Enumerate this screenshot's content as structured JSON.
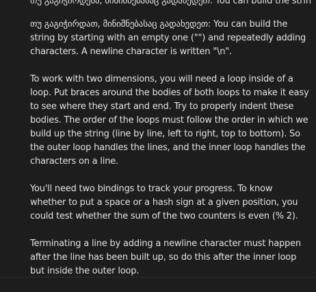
{
  "hints": {
    "top_partial_line": "თუ გაგიჭირდება, მინიშნებასაც გადახედეთ: You can build the string by starting with an empty one",
    "paragraphs": [
      "თუ გაგიჭირდათ, მინიშნებასაც გადახედეთ: You can build the string by starting with an empty one (\"\") and repeatedly adding characters. A newline character is written \"\\n\".",
      "To work with two dimensions, you will need a loop inside of a loop. Put braces around the bodies of both loops to make it easy to see where they start and end. Try to properly indent these bodies. The order of the loops must follow the order in which we build up the string (line by line, left to right, top to bottom). So the outer loop handles the lines, and the inner loop handles the characters on a line.",
      "You'll need two bindings to track your progress. To know whether to put a space or a hash sign at a given position, you could test whether the sum of the two counters is even (% 2).",
      "Terminating a line by adding a newline character must happen after the line has been built up, so do this after the inner loop but inside the outer loop."
    ]
  }
}
